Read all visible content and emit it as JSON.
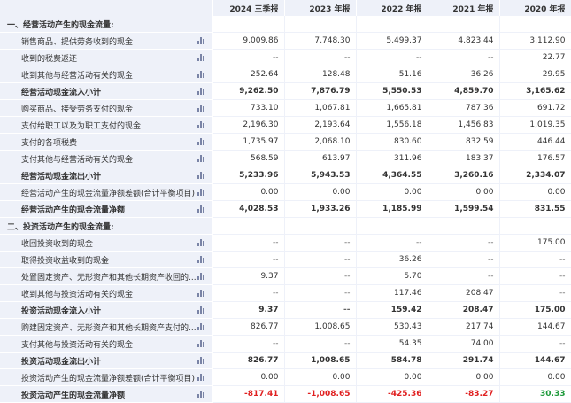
{
  "columns": [
    "2024 三季报",
    "2023 年报",
    "2022 年报",
    "2021 年报",
    "2020 年报"
  ],
  "rows": [
    {
      "label": "一、经营活动产生的现金流量:",
      "type": "section",
      "values": [
        "",
        "",
        "",
        "",
        ""
      ]
    },
    {
      "label": "销售商品、提供劳务收到的现金",
      "type": "item",
      "values": [
        "9,009.86",
        "7,748.30",
        "5,499.37",
        "4,823.44",
        "3,112.90"
      ]
    },
    {
      "label": "收到的税费返还",
      "type": "item",
      "values": [
        "--",
        "--",
        "--",
        "--",
        "22.77"
      ]
    },
    {
      "label": "收到其他与经营活动有关的现金",
      "type": "item",
      "values": [
        "252.64",
        "128.48",
        "51.16",
        "36.26",
        "29.95"
      ]
    },
    {
      "label": "经营活动现金流入小计",
      "type": "total",
      "values": [
        "9,262.50",
        "7,876.79",
        "5,550.53",
        "4,859.70",
        "3,165.62"
      ]
    },
    {
      "label": "购买商品、接受劳务支付的现金",
      "type": "item",
      "values": [
        "733.10",
        "1,067.81",
        "1,665.81",
        "787.36",
        "691.72"
      ]
    },
    {
      "label": "支付给职工以及为职工支付的现金",
      "type": "item",
      "values": [
        "2,196.30",
        "2,193.64",
        "1,556.18",
        "1,456.83",
        "1,019.35"
      ]
    },
    {
      "label": "支付的各项税费",
      "type": "item",
      "values": [
        "1,735.97",
        "2,068.10",
        "830.60",
        "832.59",
        "446.44"
      ]
    },
    {
      "label": "支付其他与经营活动有关的现金",
      "type": "item",
      "values": [
        "568.59",
        "613.97",
        "311.96",
        "183.37",
        "176.57"
      ]
    },
    {
      "label": "经营活动现金流出小计",
      "type": "total",
      "values": [
        "5,233.96",
        "5,943.53",
        "4,364.55",
        "3,260.16",
        "2,334.07"
      ]
    },
    {
      "label": "经营活动产生的现金流量净额差额(合计平衡项目)",
      "type": "item",
      "values": [
        "0.00",
        "0.00",
        "0.00",
        "0.00",
        "0.00"
      ]
    },
    {
      "label": "经营活动产生的现金流量净额",
      "type": "total",
      "values": [
        "4,028.53",
        "1,933.26",
        "1,185.99",
        "1,599.54",
        "831.55"
      ]
    },
    {
      "label": "二、投资活动产生的现金流量:",
      "type": "section",
      "values": [
        "",
        "",
        "",
        "",
        ""
      ]
    },
    {
      "label": "收回投资收到的现金",
      "type": "item",
      "values": [
        "--",
        "--",
        "--",
        "--",
        "175.00"
      ]
    },
    {
      "label": "取得投资收益收到的现金",
      "type": "item",
      "values": [
        "--",
        "--",
        "36.26",
        "--",
        "--"
      ]
    },
    {
      "label": "处置固定资产、无形资产和其他长期资产收回的...",
      "type": "item",
      "values": [
        "9.37",
        "--",
        "5.70",
        "--",
        "--"
      ]
    },
    {
      "label": "收到其他与投资活动有关的现金",
      "type": "item",
      "values": [
        "--",
        "--",
        "117.46",
        "208.47",
        "--"
      ]
    },
    {
      "label": "投资活动现金流入小计",
      "type": "total",
      "values": [
        "9.37",
        "--",
        "159.42",
        "208.47",
        "175.00"
      ]
    },
    {
      "label": "购建固定资产、无形资产和其他长期资产支付的...",
      "type": "item",
      "values": [
        "826.77",
        "1,008.65",
        "530.43",
        "217.74",
        "144.67"
      ]
    },
    {
      "label": "支付其他与投资活动有关的现金",
      "type": "item",
      "values": [
        "--",
        "--",
        "54.35",
        "74.00",
        "--"
      ]
    },
    {
      "label": "投资活动现金流出小计",
      "type": "total",
      "values": [
        "826.77",
        "1,008.65",
        "584.78",
        "291.74",
        "144.67"
      ]
    },
    {
      "label": "投资活动产生的现金流量净额差额(合计平衡项目)",
      "type": "item",
      "values": [
        "0.00",
        "0.00",
        "0.00",
        "0.00",
        "0.00"
      ]
    },
    {
      "label": "投资活动产生的现金流量净额",
      "type": "total",
      "values": [
        "-817.41",
        "-1,008.65",
        "-425.36",
        "-83.27",
        "30.33"
      ]
    }
  ],
  "colors": {
    "header_bg": "#eef1f9",
    "negative": "#e02020",
    "positive": "#1d9a3a",
    "icon": "#7a84a6"
  },
  "icons": {
    "row_chart": "bar-chart-icon"
  }
}
